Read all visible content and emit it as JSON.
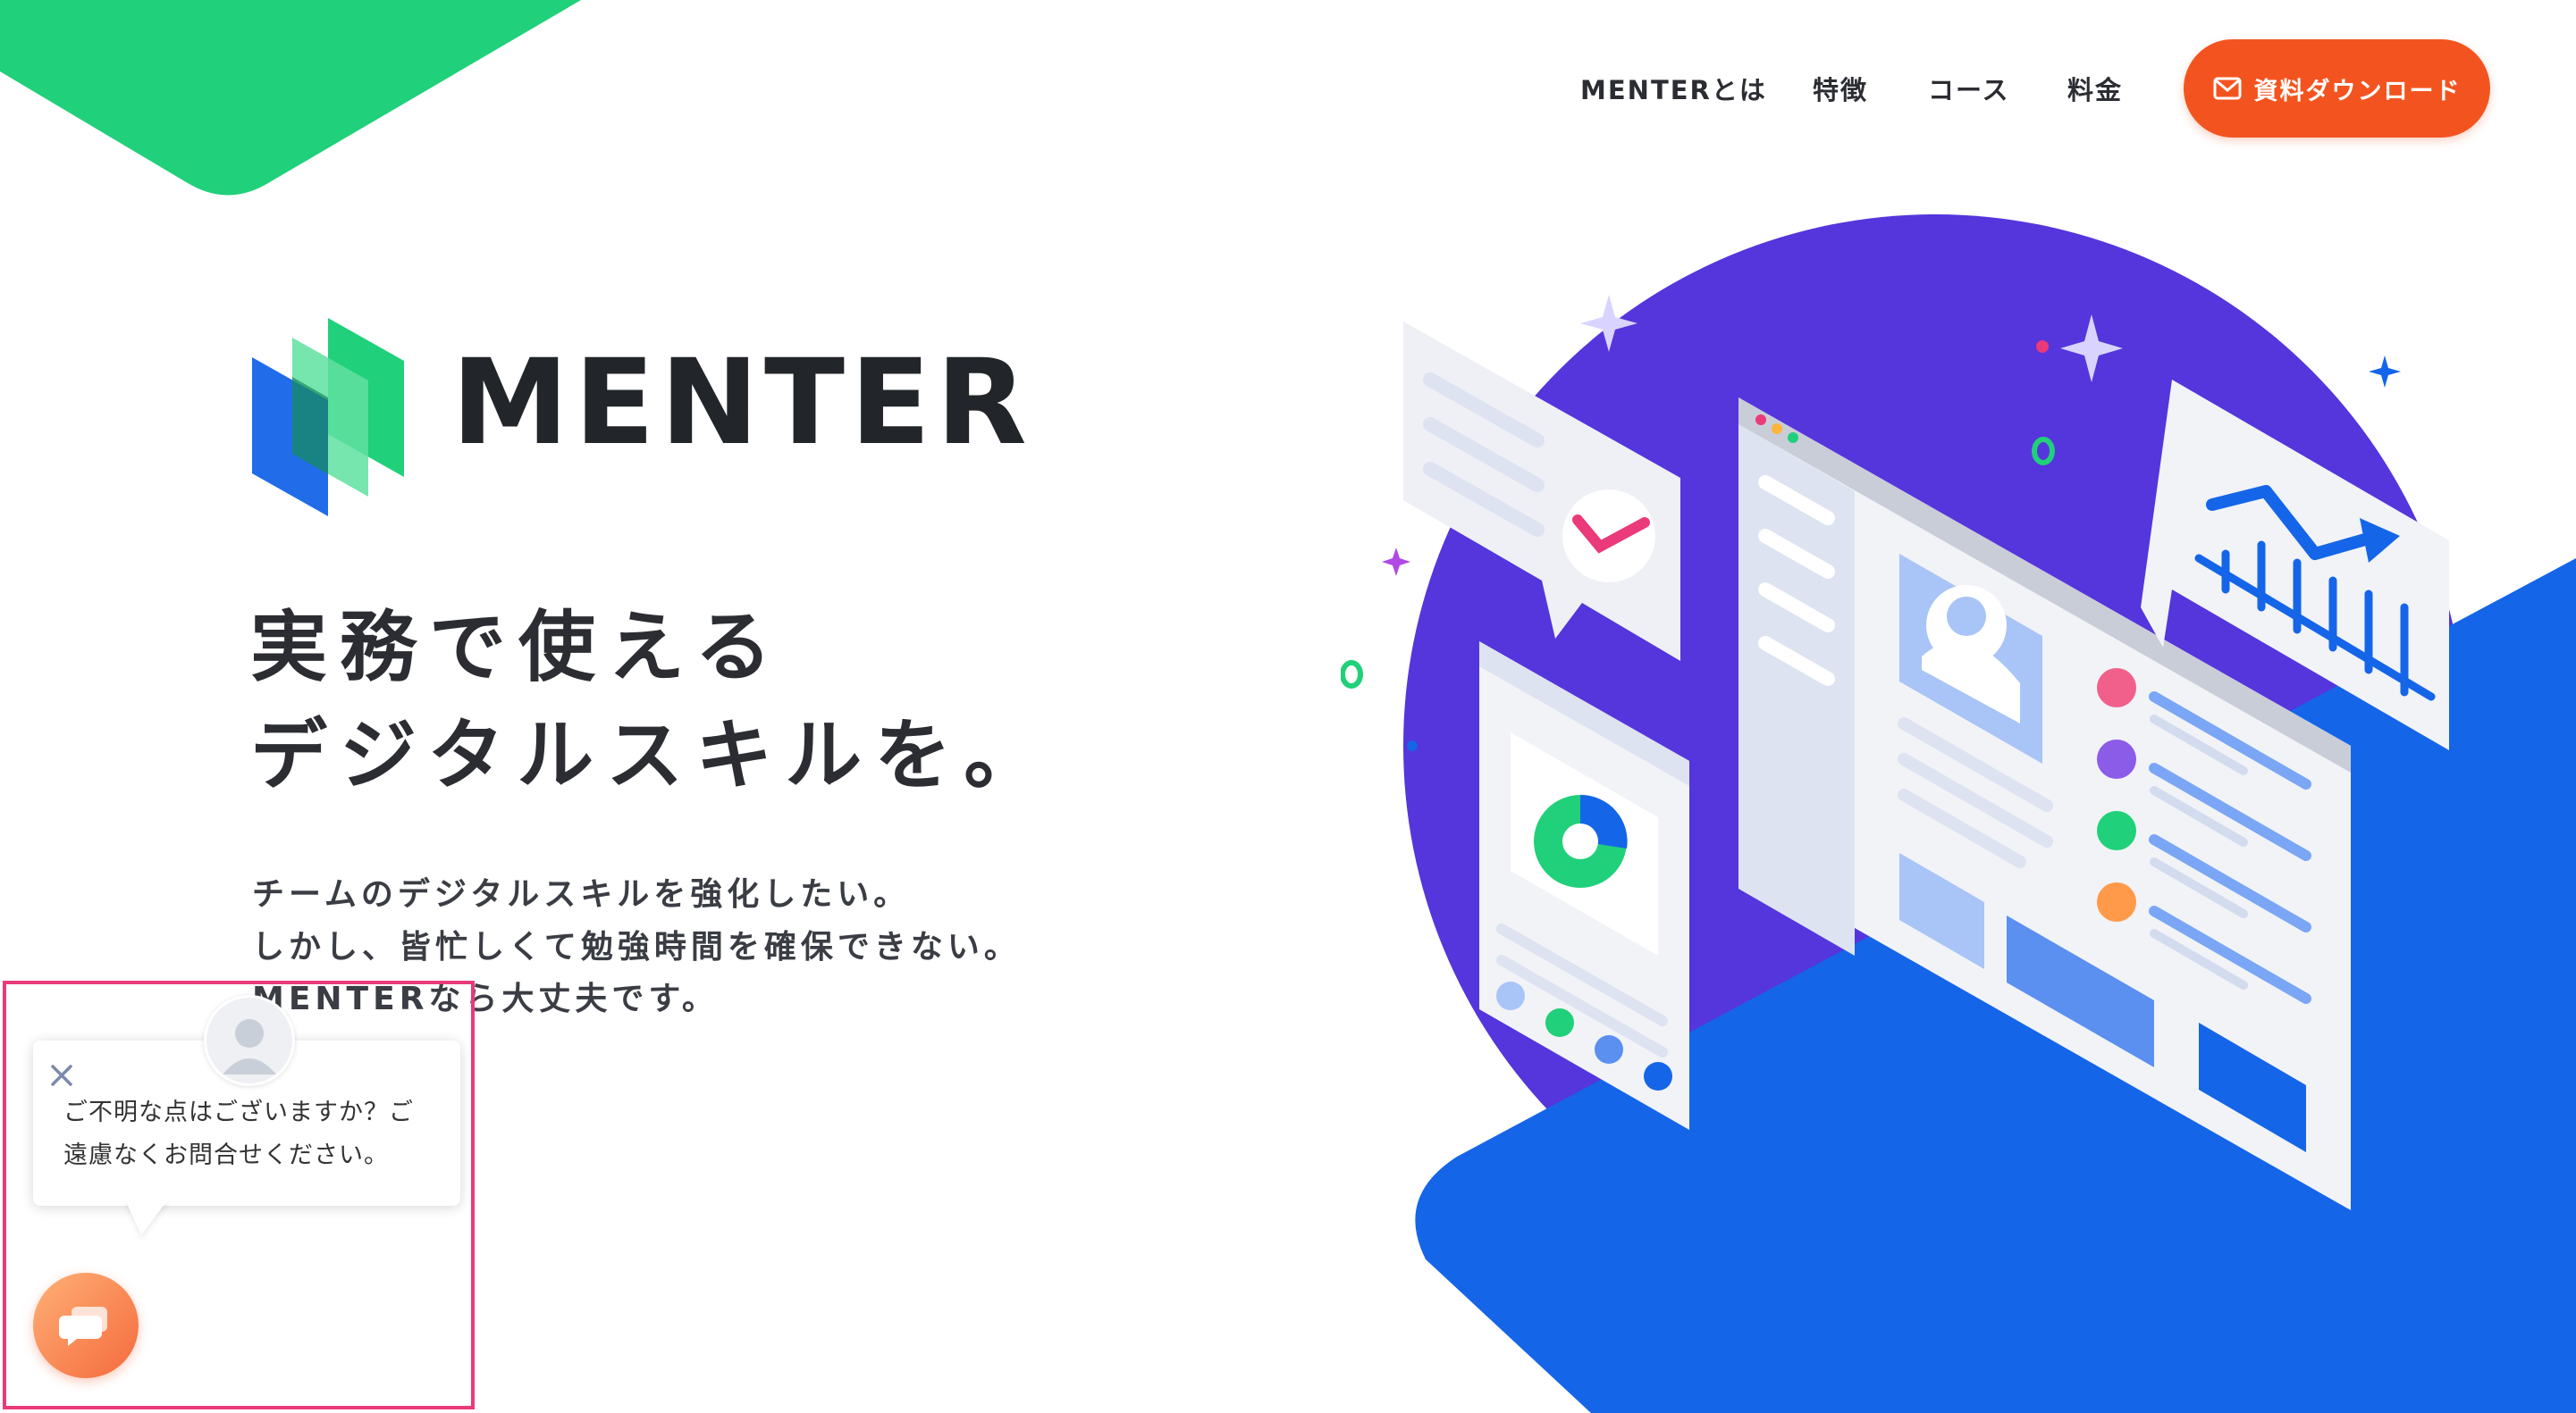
{
  "nav": {
    "items": [
      {
        "label": "MENTERとは"
      },
      {
        "label": "特徴"
      },
      {
        "label": "コース"
      },
      {
        "label": "料金"
      }
    ],
    "cta_label": "資料ダウンロード",
    "cta_icon": "mail-icon"
  },
  "brand": {
    "name": "MENTER"
  },
  "hero": {
    "headline_line1": "実務で使える",
    "headline_line2": "デジタルスキルを。",
    "lead_line1": "チームのデジタルスキルを強化したい。",
    "lead_line2": "しかし、皆忙しくて勉強時間を確保できない。",
    "lead_line3": "MENTERなら大丈夫です。"
  },
  "chat": {
    "message_line1": "ご不明な点はございますか？ご",
    "message_line2": "遠慮なくお問合せください。",
    "close_icon": "close-icon",
    "avatar_icon": "user-avatar-icon",
    "launcher_icon": "chat-bubble-icon"
  },
  "colors": {
    "accent_green": "#21d07a",
    "cta_orange": "#f3541f",
    "illustration_purple": "#5535dc",
    "illustration_blue": "#1565e8",
    "highlight_pink": "#ea3a7a"
  }
}
